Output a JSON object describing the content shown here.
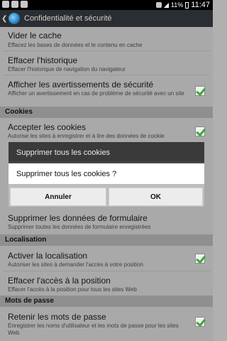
{
  "status": {
    "battery": "11%",
    "time": "11:47"
  },
  "actionbar": {
    "title": "Confidentialité et sécurité"
  },
  "items": {
    "clear_cache": {
      "title": "Vider le cache",
      "subtitle": "Effacez les bases de données et le contenu en cache"
    },
    "clear_history": {
      "title": "Effacer l'historique",
      "subtitle": "Effacer l'historique de navigation du navigateur"
    },
    "security_warnings": {
      "title": "Afficher les avertissements de sécurité",
      "subtitle": "Afficher un avertissement en cas de problème de sécurité avec un site",
      "checked": true
    },
    "accept_cookies": {
      "title": "Accepter les cookies",
      "subtitle": "Autorise les sites à enregistrer et à lire des données de cookie",
      "checked": true
    },
    "clear_form_data": {
      "title": "Supprimer les données de formulaire",
      "subtitle": "Supprimer toutes les données de formulaire enregistrées"
    },
    "enable_location": {
      "title": "Activer la localisation",
      "subtitle": "Autoriser les sites à demander l'accès à votre position",
      "checked": true
    },
    "clear_location": {
      "title": "Effacer l'accès à la position",
      "subtitle": "Effacer l'accès à la position pour tous les sites Web"
    },
    "remember_passwords": {
      "title": "Retenir les mots de passe",
      "subtitle": "Enregistrer les noms d'utilisateur et les mots de passe pour les sites Web",
      "checked": true
    }
  },
  "sections": {
    "cookies": "Cookies",
    "location": "Localisation",
    "passwords": "Mots de passe"
  },
  "dialog": {
    "title": "Supprimer tous les cookies",
    "message": "Supprimer tous les cookies ?",
    "cancel": "Annuler",
    "ok": "OK"
  }
}
